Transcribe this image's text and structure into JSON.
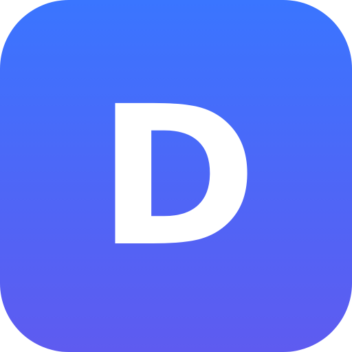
{
  "icon": {
    "letter": "D",
    "gradient_top": "#3a75ff",
    "gradient_bottom": "#5e5bf0",
    "letter_color": "#ffffff"
  }
}
